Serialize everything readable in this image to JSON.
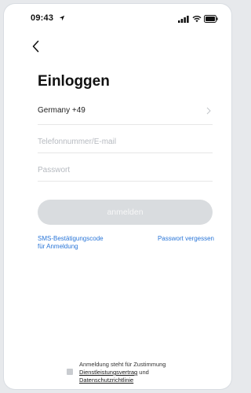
{
  "status_bar": {
    "time": "09:43",
    "icons": [
      "location-arrow-icon",
      "cellular-signal-icon",
      "wifi-icon",
      "battery-icon"
    ]
  },
  "nav": {
    "back_icon": "chevron-left-icon"
  },
  "page": {
    "title": "Einloggen"
  },
  "form": {
    "country_label": "Germany +49",
    "country_icon": "chevron-right-icon",
    "phone_placeholder": "Telefonnummer/E-mail",
    "password_placeholder": "Passwort",
    "submit_label": "anmelden"
  },
  "links": {
    "sms_login_line1": "SMS-Bestätigungscode",
    "sms_login_line2": "für Anmeldung",
    "forgot_password": "Passwort vergessen"
  },
  "consent": {
    "text_line1": "Anmeldung steht für Zustimmung",
    "service_agreement": "Dienstleistungsvertrag",
    "and": "und",
    "privacy_policy": "Datenschutzrichtlinie"
  },
  "colors": {
    "link_blue": "#2a76d8",
    "button_disabled": "#d9dcdf",
    "placeholder_gray": "#b6bac0"
  }
}
